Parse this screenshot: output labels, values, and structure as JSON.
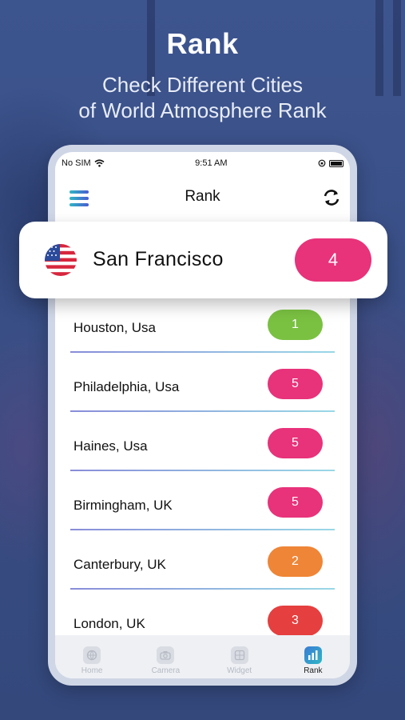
{
  "header": {
    "title": "Rank",
    "subtitle_line1": "Check Different Cities",
    "subtitle_line2": "of World Atmosphere Rank"
  },
  "status_bar": {
    "carrier": "No SIM",
    "time": "9:51 AM"
  },
  "app_bar": {
    "title": "Rank"
  },
  "featured": {
    "city": "San Francisco",
    "rank": "4",
    "color": "#e8327a"
  },
  "cities": [
    {
      "name": "Houston, Usa",
      "rank": "1",
      "color": "#7ac142"
    },
    {
      "name": "Philadelphia, Usa",
      "rank": "5",
      "color": "#e8327a"
    },
    {
      "name": "Haines, Usa",
      "rank": "5",
      "color": "#e8327a"
    },
    {
      "name": "Birmingham, UK",
      "rank": "5",
      "color": "#e8327a"
    },
    {
      "name": "Canterbury, UK",
      "rank": "2",
      "color": "#ef8536"
    },
    {
      "name": "London, UK",
      "rank": "3",
      "color": "#e53f3f"
    }
  ],
  "tabs": [
    {
      "label": "Home",
      "icon": "globe-icon",
      "active": false
    },
    {
      "label": "Camera",
      "icon": "camera-icon",
      "active": false
    },
    {
      "label": "Widget",
      "icon": "widget-icon",
      "active": false
    },
    {
      "label": "Rank",
      "icon": "rank-chart-icon",
      "active": true
    }
  ]
}
